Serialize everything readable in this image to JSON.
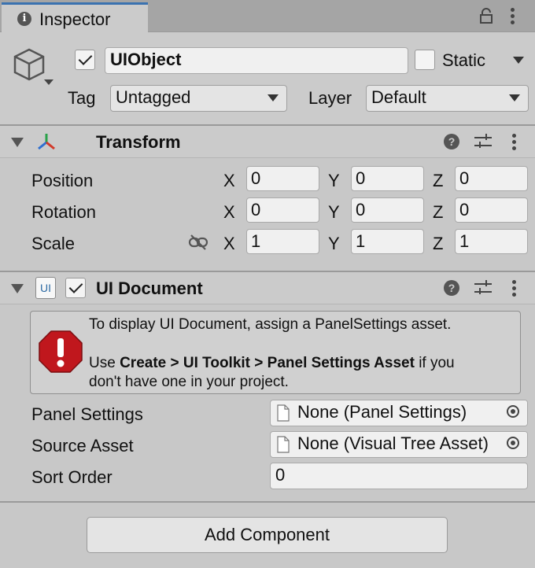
{
  "tab": {
    "title": "Inspector"
  },
  "header": {
    "object_name": "UIObject",
    "active": true,
    "static_label": "Static",
    "static_checked": false,
    "tag_label": "Tag",
    "tag_value": "Untagged",
    "layer_label": "Layer",
    "layer_value": "Default"
  },
  "transform": {
    "title": "Transform",
    "rows": [
      {
        "label": "Position",
        "x": "0",
        "y": "0",
        "z": "0"
      },
      {
        "label": "Rotation",
        "x": "0",
        "y": "0",
        "z": "0"
      },
      {
        "label": "Scale",
        "x": "1",
        "y": "1",
        "z": "1"
      }
    ],
    "axes": {
      "x": "X",
      "y": "Y",
      "z": "Z"
    }
  },
  "ui_document": {
    "icon_text": "UI",
    "title": "UI Document",
    "enabled": true,
    "help_line1": "To display UI Document, assign a PanelSettings asset.",
    "help_line2_pre": "Use ",
    "help_line2_bold": "Create > UI Toolkit > Panel Settings Asset",
    "help_line2_post": " if you",
    "help_line3": "don't have one in your project.",
    "panel_settings_label": "Panel Settings",
    "panel_settings_value": "None (Panel Settings)",
    "source_asset_label": "Source Asset",
    "source_asset_value": "None (Visual Tree Asset)",
    "sort_order_label": "Sort Order",
    "sort_order_value": "0"
  },
  "footer": {
    "add_component_label": "Add Component"
  },
  "colors": {
    "tab_accent": "#3a72b0",
    "error_red": "#c0171d",
    "ui_icon_blue": "#2d6aa3"
  }
}
